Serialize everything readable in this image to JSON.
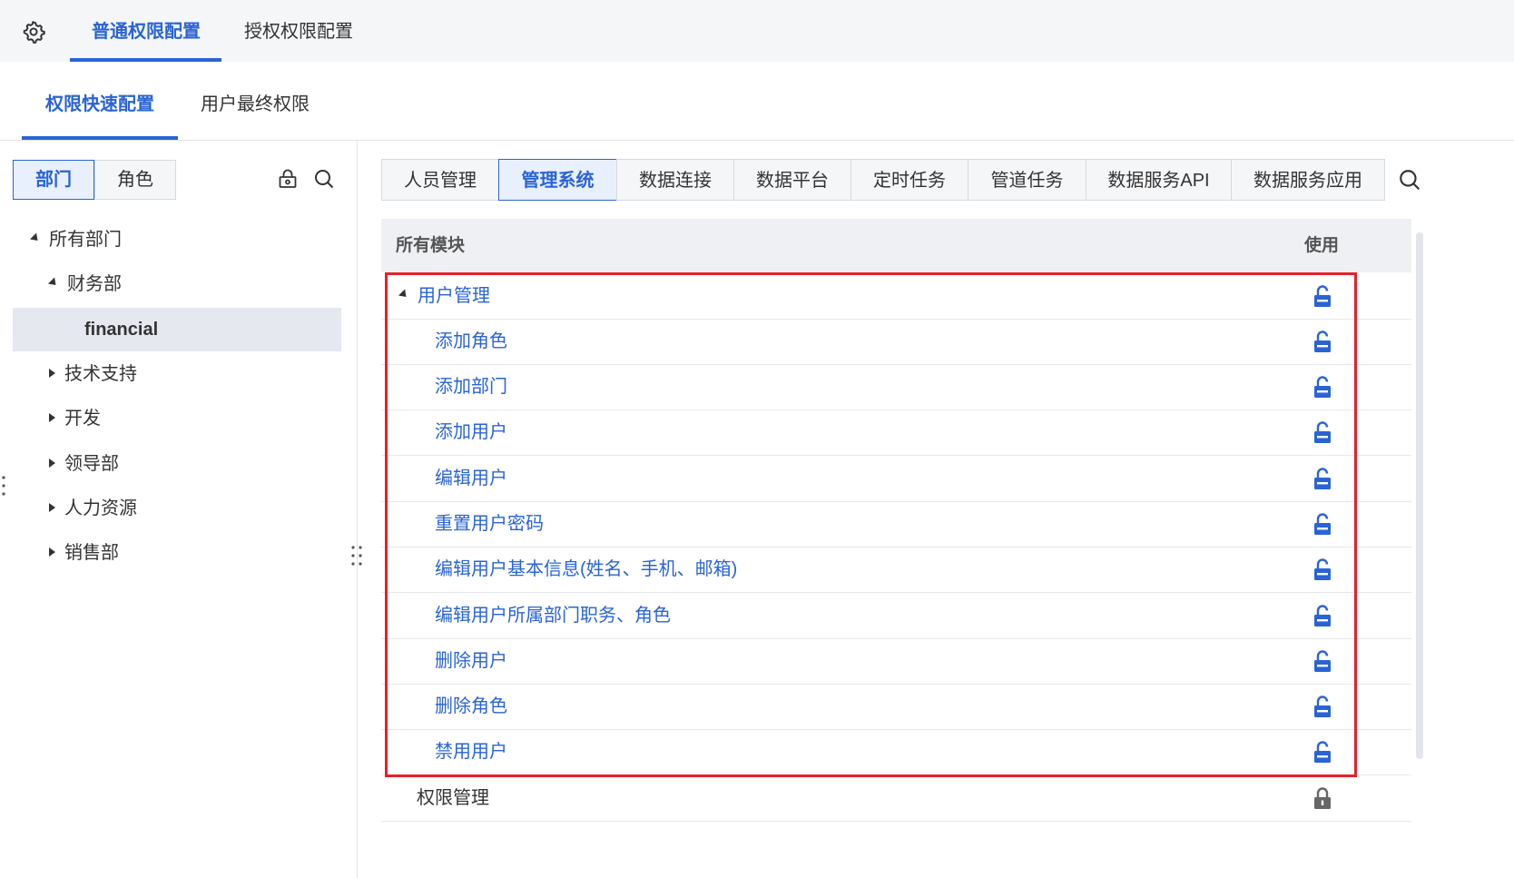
{
  "top_tabs": [
    {
      "label": "普通权限配置",
      "active": true
    },
    {
      "label": "授权权限配置",
      "active": false
    }
  ],
  "sub_tabs": [
    {
      "label": "权限快速配置",
      "active": true
    },
    {
      "label": "用户最终权限",
      "active": false
    }
  ],
  "left": {
    "segments": [
      {
        "label": "部门",
        "active": true
      },
      {
        "label": "角色",
        "active": false
      }
    ],
    "icons": [
      "lock-settings-icon",
      "search-icon"
    ],
    "tree": {
      "root": "所有部门",
      "finance": "财务部",
      "finance_child": "financial",
      "tech": "技术支持",
      "dev": "开发",
      "leadership": "领导部",
      "hr": "人力资源",
      "sales": "销售部"
    }
  },
  "module_tabs": [
    "人员管理",
    "管理系统",
    "数据连接",
    "数据平台",
    "定时任务",
    "管道任务",
    "数据服务API",
    "数据服务应用"
  ],
  "active_module_tab": "管理系统",
  "table": {
    "col_module": "所有模块",
    "col_use": "使用",
    "rows": [
      {
        "label": "用户管理",
        "level": 0,
        "expanded": true,
        "lock": "unlocked"
      },
      {
        "label": "添加角色",
        "level": 1,
        "lock": "unlocked"
      },
      {
        "label": "添加部门",
        "level": 1,
        "lock": "unlocked"
      },
      {
        "label": "添加用户",
        "level": 1,
        "lock": "unlocked"
      },
      {
        "label": "编辑用户",
        "level": 1,
        "lock": "unlocked"
      },
      {
        "label": "重置用户密码",
        "level": 1,
        "lock": "unlocked"
      },
      {
        "label": "编辑用户基本信息(姓名、手机、邮箱)",
        "level": 1,
        "lock": "unlocked"
      },
      {
        "label": "编辑用户所属部门职务、角色",
        "level": 1,
        "lock": "unlocked"
      },
      {
        "label": "删除用户",
        "level": 1,
        "lock": "unlocked"
      },
      {
        "label": "删除角色",
        "level": 1,
        "lock": "unlocked"
      },
      {
        "label": "禁用用户",
        "level": 1,
        "lock": "unlocked"
      },
      {
        "label": "权限管理",
        "level": 0,
        "lock": "locked"
      }
    ]
  },
  "colors": {
    "accent": "#2a64d4",
    "highlight": "#e8202a",
    "locked": "#666666"
  }
}
